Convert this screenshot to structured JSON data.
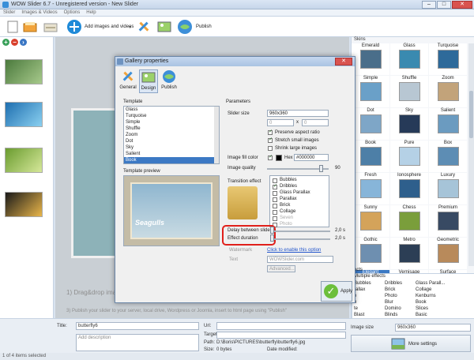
{
  "window": {
    "title": "WOW Slider 6.7 - Unregistered version - New Slider",
    "buttons": [
      "–",
      "□",
      "✕"
    ]
  },
  "menu": [
    "Slider",
    "Images & Videos",
    "Options",
    "Help"
  ],
  "toolbar": {
    "add_label": "Add images and videos",
    "publish_label": "Publish"
  },
  "canvas": {
    "drag_hint": "1) Drag&drop ima",
    "publish_hint": "3) Publish your slider to your server, local drive, Wordpress or Joomla, insert to html page using",
    "publish_quote": "\"Publish\""
  },
  "skins": {
    "header": "Skins",
    "items": [
      "Emerald",
      "Glass",
      "Turquoise",
      "Simple",
      "Shuffle",
      "Zoom",
      "Dot",
      "Sky",
      "Salient",
      "Book",
      "Pure",
      "Box",
      "Fresh",
      "Ionosphere",
      "Luxury",
      "Sunny",
      "Chess",
      "Premium",
      "Gothic",
      "Metro",
      "Geometric",
      "Elegant",
      "Vernisage",
      "Surface"
    ],
    "selected_index": 21
  },
  "effects": {
    "header": "ects",
    "multiple": "Multiple effects",
    "items": [
      "Bubbles",
      "Dribbles",
      "Glass Parall...",
      "rallax",
      "Brick",
      "Collage",
      "e",
      "Photo",
      "Kenburns",
      "n",
      "Blur",
      "Book",
      "te",
      "Domino",
      "Slices",
      "Blast",
      "Blinds",
      "Basic"
    ]
  },
  "bottom": {
    "title_label": "Title:",
    "title_value": "butterfly6",
    "desc_placeholder": "Add description",
    "url_label": "Url:",
    "target_label": "Target",
    "path_label": "Path:",
    "path_value": "D:\\Boris\\PICTURES\\butterfly\\butterfly6.jpg",
    "size_label": "Size:",
    "size_value": "0 bytes",
    "date_label": "Date modified:",
    "image_size_label": "Image size",
    "image_size_value": "960x360",
    "more_settings": "More settings"
  },
  "status": {
    "text": "1 of 4 items selected"
  },
  "dialog": {
    "title": "Gallery properties",
    "tabs": [
      "General",
      "Design",
      "Publish"
    ],
    "template_label": "Template",
    "templates": [
      "Glass",
      "Turquoise",
      "Simple",
      "Shuffle",
      "Zoom",
      "Dot",
      "Sky",
      "Salient",
      "Book"
    ],
    "template_selected": 8,
    "template_preview_label": "Template preview",
    "preview_caption": "Seagulls",
    "parameters_label": "Parameters",
    "slider_size_label": "Slider size",
    "slider_size_value": "960x360",
    "size_w": "0",
    "size_x": "x",
    "size_h": "0",
    "preserve_aspect": "Preserve aspect ratio",
    "stretch_small": "Stretch small images",
    "shrink_large": "Shrink large images",
    "fill_color_label": "Image fill color",
    "hex_label": "Hex",
    "hex_value": "#000000",
    "quality_label": "Image quality",
    "quality_value": "90",
    "transition_label": "Transition effect",
    "transitions": [
      "Bubbles",
      "Dribbles",
      "Glass Parallax",
      "Parallax",
      "Brick",
      "Collage",
      "Seven",
      "Photo"
    ],
    "transition_checked": [
      false,
      true,
      false,
      false,
      false,
      false,
      false,
      false
    ],
    "delay_label": "Delay between slides",
    "delay_value": "2,0 s",
    "duration_label": "Effect duration",
    "duration_value": "2,0 s",
    "watermark_label": "Watermark",
    "watermark_link": "Click to enable this option",
    "text_label": "Text",
    "text_value": "WOWSlider.com",
    "advanced_label": "Advanced...",
    "apply_label": "Apply"
  }
}
